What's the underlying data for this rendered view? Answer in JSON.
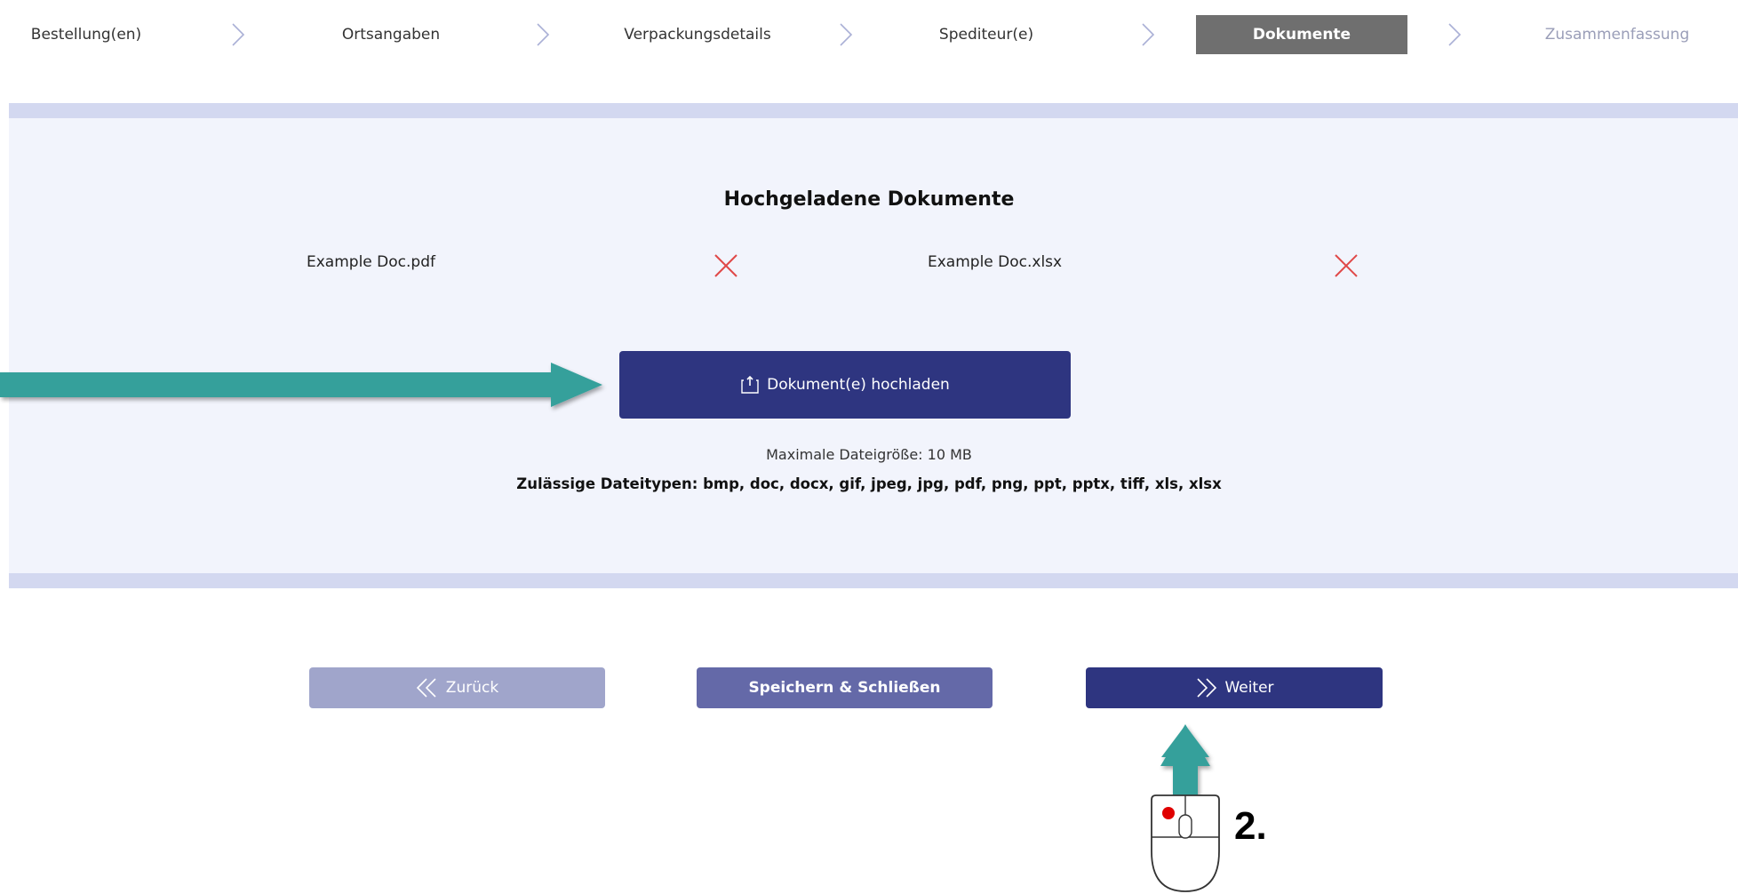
{
  "stepper": {
    "steps": [
      {
        "label": "Bestellung(en)",
        "state": "done"
      },
      {
        "label": "Ortsangaben",
        "state": "done"
      },
      {
        "label": "Verpackungsdetails",
        "state": "done"
      },
      {
        "label": "Spediteur(e)",
        "state": "done"
      },
      {
        "label": "Dokumente",
        "state": "active"
      },
      {
        "label": "Zusammenfassung",
        "state": "disabled"
      }
    ]
  },
  "documents": {
    "title": "Hochgeladene Dokumente",
    "files": [
      {
        "name": "Example Doc.pdf"
      },
      {
        "name": "Example Doc.xlsx"
      }
    ],
    "upload_label": "Dokument(e) hochladen",
    "max_size": "Maximale Dateigröße: 10 MB",
    "allowed_types": "Zulässige Dateitypen: bmp, doc, docx, gif, jpeg, jpg, pdf, png, ppt, pptx, tiff, xls, xlsx"
  },
  "actions": {
    "back_label": "Zurück",
    "save_label": "Speichern & Schließen",
    "next_label": "Weiter"
  },
  "annotation": {
    "step_number": "2."
  },
  "colors": {
    "primary": "#2e3580",
    "secondary": "#6469a8",
    "disabled": "#a0a5cb",
    "active_step": "#6f6f6f",
    "panel_bg": "#f2f4fc",
    "band": "#d3d8f0",
    "remove_icon": "#e04848",
    "annotation_arrow": "#36a09b",
    "mouse_button": "#e00000"
  },
  "icons": {
    "step_separator": "chevron-right-icon",
    "remove": "close-icon",
    "upload": "upload-icon",
    "back": "double-chevron-left-icon",
    "next": "double-chevron-right-icon"
  }
}
